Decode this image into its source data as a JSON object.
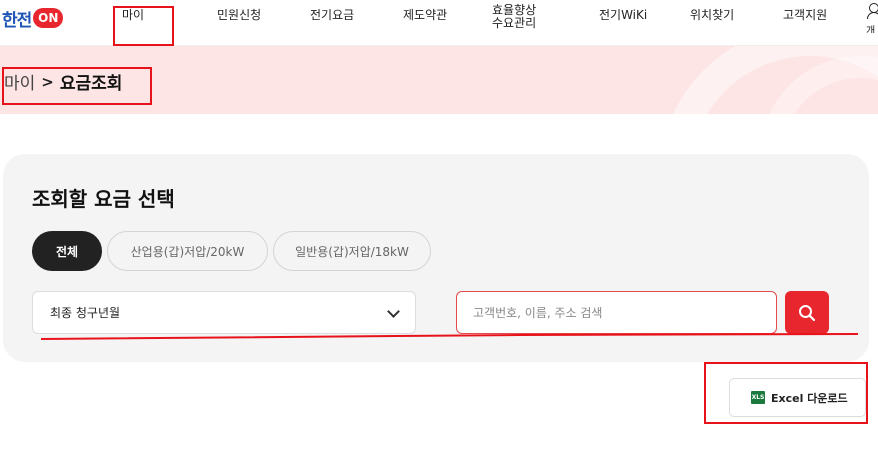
{
  "header": {
    "logo_text": "한전",
    "logo_badge": "ON",
    "nav": [
      {
        "label": "마이"
      },
      {
        "label": "민원신청"
      },
      {
        "label": "전기요금"
      },
      {
        "label": "제도약관"
      },
      {
        "label_line1": "효율향상",
        "label_line2": "수요관리"
      },
      {
        "label": "전기WiKi"
      },
      {
        "label": "위치찾기"
      },
      {
        "label": "고객지원"
      }
    ],
    "user_label": "개"
  },
  "breadcrumb": {
    "home": "마이",
    "separator": ">",
    "current": "요금조회"
  },
  "panel": {
    "title": "조회할 요금 선택",
    "chips": [
      {
        "label": "전체",
        "active": true
      },
      {
        "label": "산업용(갑)저압/20kW",
        "active": false
      },
      {
        "label": "일반용(갑)저압/18kW",
        "active": false
      }
    ],
    "select_value": "최종 청구년월",
    "search_placeholder": "고객번호, 이름, 주소 검색",
    "search_value": ""
  },
  "excel_button": {
    "badge": "XLS",
    "label": "Excel 다운로드"
  },
  "colors": {
    "brand_blue": "#1f56b5",
    "brand_red": "#e8262e",
    "banner_pink": "#fde5e5",
    "annotation_red": "#e8121a"
  }
}
